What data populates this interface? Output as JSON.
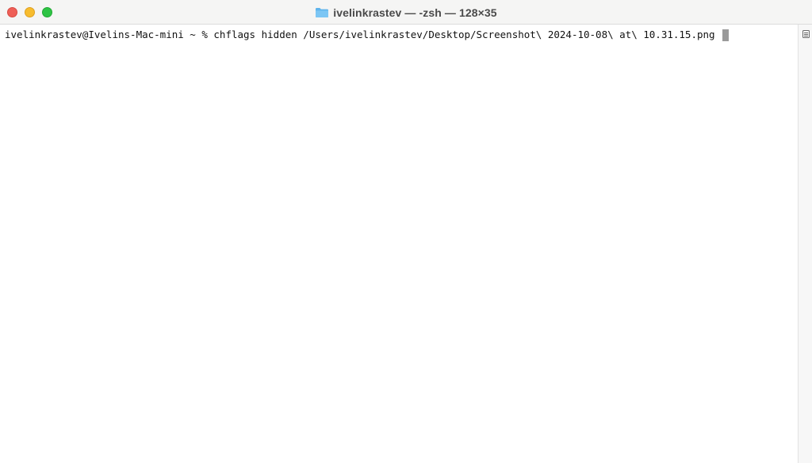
{
  "window": {
    "title": "ivelinkrastev — -zsh — 128×35",
    "title_icon": "folder-icon",
    "traffic_lights": [
      {
        "name": "close",
        "color": "#ee5f57"
      },
      {
        "name": "minimize",
        "color": "#f7bc2e"
      },
      {
        "name": "zoom",
        "color": "#2ec444"
      }
    ]
  },
  "terminal": {
    "prompt": "ivelinkrastev@Ivelins-Mac-mini ~ % ",
    "command": "chflags hidden /Users/ivelinkrastev/Desktop/Screenshot\\ 2024-10-08\\ at\\ 10.31.15.png ",
    "cursor_icon": "block-cursor",
    "text_color": "#111111",
    "background": "#ffffff"
  },
  "scrollbar": {
    "icon": "list-toggle-icon"
  }
}
